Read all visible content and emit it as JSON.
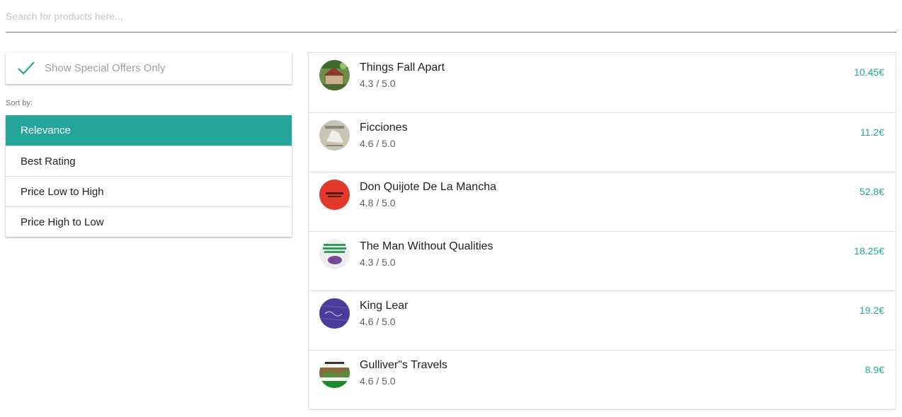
{
  "search": {
    "placeholder": "Search for products here...",
    "value": ""
  },
  "filters": {
    "special_offers_label": "Show Special Offers Only",
    "special_offers_checked": true
  },
  "sort": {
    "label": "Sort by:",
    "options": [
      "Relevance",
      "Best Rating",
      "Price Low to High",
      "Price High to Low"
    ],
    "selected": "Relevance"
  },
  "colors": {
    "accent": "#26a69a"
  },
  "products": [
    {
      "title": "Things Fall Apart",
      "rating": "4.3 / 5.0",
      "price": "10.45€",
      "thumb": "village-scene"
    },
    {
      "title": "Ficciones",
      "rating": "4.6 / 5.0",
      "price": "11.2€",
      "thumb": "grey-cover"
    },
    {
      "title": "Don Quijote De La Mancha",
      "rating": "4.8 / 5.0",
      "price": "52.8€",
      "thumb": "red-cover"
    },
    {
      "title": "The Man Without Qualities",
      "rating": "4.3 / 5.0",
      "price": "18.25€",
      "thumb": "green-purple-cover"
    },
    {
      "title": "King Lear",
      "rating": "4.6 / 5.0",
      "price": "19.2€",
      "thumb": "purple-cover"
    },
    {
      "title": "Gulliver\"s Travels",
      "rating": "4.6 / 5.0",
      "price": "8.9€",
      "thumb": "landscape-cover"
    }
  ]
}
